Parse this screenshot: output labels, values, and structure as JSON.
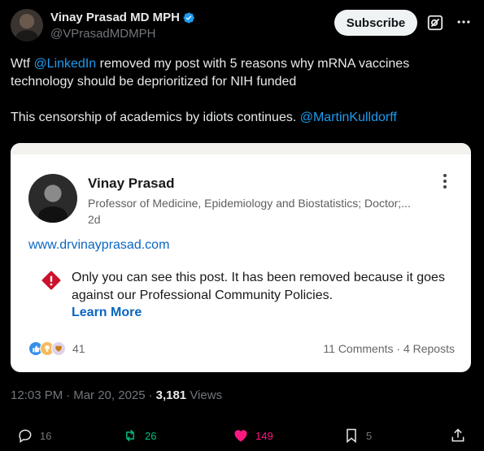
{
  "author": {
    "name": "Vinay Prasad MD MPH",
    "handle": "@VPrasadMDMPH",
    "verified": true
  },
  "header": {
    "subscribe_label": "Subscribe",
    "grok_icon": "grok-icon",
    "more_icon": "more-icon"
  },
  "tweet": {
    "line1_pre": "Wtf ",
    "mention1": "@LinkedIn",
    "line1_post": " removed my post with 5 reasons why mRNA vaccines technology should be deprioritized for NIH funded",
    "line2_pre": "This censorship of academics by idiots continues.  ",
    "mention2": "@MartinKulldorff"
  },
  "linkedin_card": {
    "name": "Vinay Prasad",
    "headline": "Professor of Medicine, Epidemiology and Biostatistics; Doctor;...",
    "time": "2d",
    "link": "www.drvinayprasad.com",
    "notice": "Only you can see this post. It has been removed because it goes against our Professional Community Policies.",
    "learn_more": "Learn More",
    "reaction_count": "41",
    "comments": "11 Comments",
    "reposts": "4 Reposts",
    "separator": "·"
  },
  "meta": {
    "time": "12:03 PM",
    "date": "Mar 20, 2025",
    "views_count": "3,181",
    "views_label": "Views",
    "separator": "·"
  },
  "actions": {
    "replies": "16",
    "reposts": "26",
    "likes": "149",
    "bookmarks": "5"
  },
  "colors": {
    "accent": "#1d9bf0",
    "linkedin_blue": "#0a66c2",
    "repost_green": "#00ba7c",
    "like_pink": "#f91880",
    "warning_red": "#cb112d"
  }
}
